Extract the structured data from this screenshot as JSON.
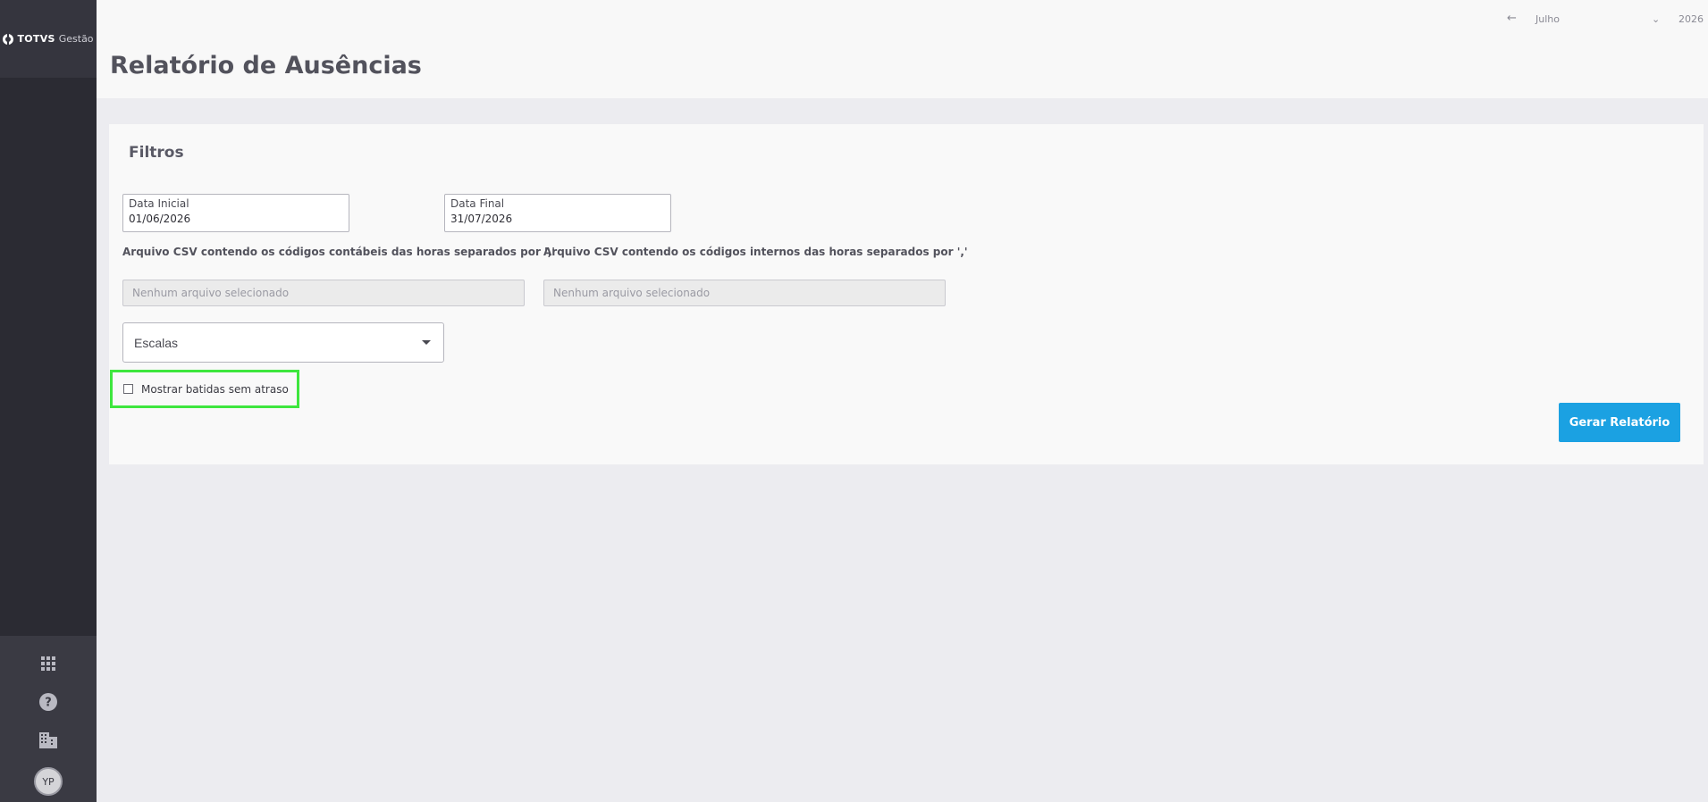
{
  "sidebar": {
    "logo": {
      "brand": "TOTVS",
      "product": "Gestão"
    },
    "icons": [
      "apps-grid-icon",
      "help-icon",
      "company-building-icon"
    ],
    "avatar_initials": "YP"
  },
  "header": {
    "title": "Relatório de Ausências",
    "period": {
      "month": "Julho",
      "year": "2026"
    }
  },
  "filters": {
    "title": "Filtros",
    "start_date": {
      "label": "Data Inicial",
      "value": "01/06/2026"
    },
    "end_date": {
      "label": "Data Final",
      "value": "31/07/2026"
    },
    "csv_accounting": {
      "label": "Arquivo CSV contendo os códigos contábeis das horas separados por ','",
      "placeholder": "Nenhum arquivo selecionado"
    },
    "csv_internal": {
      "label": "Arquivo CSV contendo os códigos internos das horas separados por ','",
      "placeholder": "Nenhum arquivo selecionado"
    },
    "scales_select": {
      "value": "Escalas"
    },
    "show_punches_checkbox": {
      "label": "Mostrar batidas sem atraso",
      "checked": false
    },
    "generate_button": "Gerar Relatório"
  },
  "colors": {
    "sidebar_bg": "#2b2b33",
    "primary_button": "#1ba1e2",
    "highlight": "#3ee63e"
  }
}
